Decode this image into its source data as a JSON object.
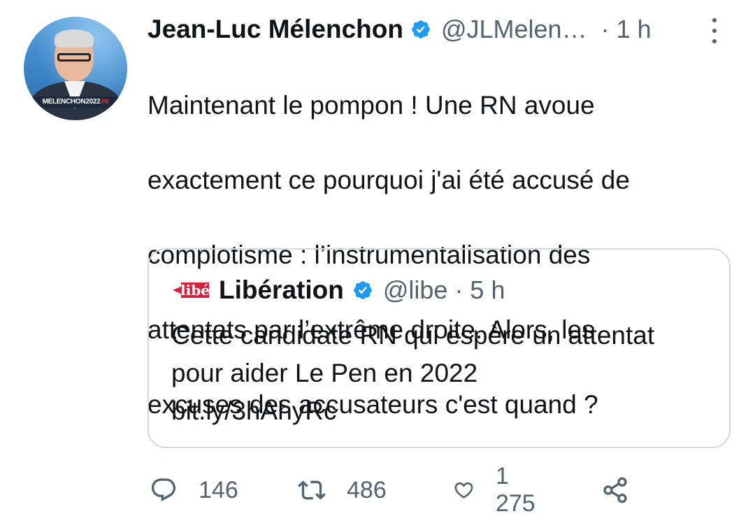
{
  "author": {
    "name": "Jean-Luc Mélenchon",
    "handle": "@JLMelen…",
    "time": "· 1 h",
    "avatar_banner": "MELENCHON2022",
    "avatar_banner_suffix": ".FR",
    "verified": true
  },
  "tweet": {
    "text_lines": [
      "Maintenant le pompon ! Une RN avoue",
      "exactement ce pourquoi j'ai été accusé de",
      "complotisme : l’instrumentalisation des",
      "attentats par l’extrême droite. Alors, les",
      "excuses des accusateurs c'est quand ?"
    ]
  },
  "quoted_tweet": {
    "logo_text": "libé",
    "name": "Libération",
    "handle": "@libe",
    "time": "· 5 h",
    "verified": true,
    "text_lines": [
      "Cette candidate RN qui espère un attentat",
      "pour aider Le Pen en 2022",
      "bit.ly/3hAhyRc"
    ]
  },
  "actions": {
    "reply_count": "146",
    "retweet_count": "486",
    "like_count": "1 275",
    "reply_icon": "reply-icon",
    "retweet_icon": "retweet-icon",
    "like_icon": "heart-icon",
    "share_icon": "share-icon"
  },
  "colors": {
    "text": "#0f1419",
    "secondary": "#536471",
    "verified": "#1d9bf0",
    "border": "#cfd9de",
    "libe_red": "#d4213d"
  }
}
